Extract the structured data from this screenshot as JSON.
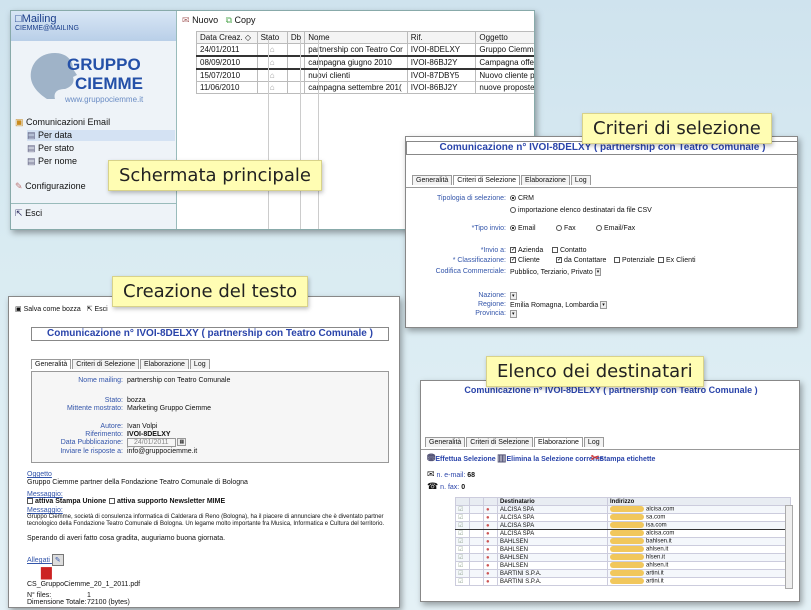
{
  "callouts": {
    "main": "Schermata principale",
    "criteri": "Criteri di selezione",
    "creazione": "Creazione del testo",
    "elenco": "Elenco dei destinatari"
  },
  "main": {
    "app_title": "Mailing",
    "app_subtitle": "CIEMME@MAILING",
    "logo_line1": "GRUPPO",
    "logo_line2": "CIEMME",
    "logo_url": "www.gruppociemme.it",
    "nav_section": "Comunicazioni Email",
    "nav_items": [
      "Per data",
      "Per stato",
      "Per nome"
    ],
    "configurazione": "Configurazione",
    "esci": "Esci",
    "toolbar": {
      "nuovo": "Nuovo",
      "copy": "Copy"
    },
    "columns": [
      "Data Creaz.",
      "Stato",
      "Db",
      "Nome",
      "Rif.",
      "Oggetto"
    ],
    "rows": [
      [
        "24/01/2011",
        "partnership con Teatro Cor",
        "IVOI-8DELXY",
        "Gruppo Ciemme"
      ],
      [
        "08/09/2010",
        "campagna giugno 2010",
        "IVOI-86BJ2Y",
        "Campagna offerta"
      ],
      [
        "15/07/2010",
        "nuovi clienti",
        "IVOI-87DBY5",
        "Nuovo cliente per"
      ],
      [
        "11/06/2010",
        "campagna settembre 201(",
        "IVOI-86BJ2Y",
        "nuove proposte d"
      ]
    ]
  },
  "criteri": {
    "title": "Comunicazione n° IVOI-8DELXY ( partnership con Teatro Comunale )",
    "tabs": [
      "Generalità",
      "Criteri di Selezione",
      "Elaborazione",
      "Log"
    ],
    "tipologia_label": "Tipologia di selezione:",
    "tipologia_opt1": "CRM",
    "tipologia_opt2": "importazione elenco destinatari da file CSV",
    "tipo_invio_label": "*Tipo invio:",
    "tipo_invio_opts": [
      "Email",
      "Fax",
      "Email/Fax"
    ],
    "invio_a_label": "*Invio a:",
    "invio_a_opts": [
      "Azienda",
      "Contatto"
    ],
    "classificazione_label": "* Classificazione:",
    "classificazione_opts": [
      "Cliente",
      "da Contattare",
      "Potenziale",
      "Ex Clienti"
    ],
    "codifica_label": "Codifica Commerciale:",
    "codifica_value": "Pubblico, Terziario, Privato",
    "nazione_label": "Nazione:",
    "regione_label": "Regione:",
    "regione_value": "Emilia Romagna, Lombardia",
    "provincia_label": "Provincia:"
  },
  "creazione": {
    "toolbar_save": "Salva come bozza",
    "toolbar_exit": "Esci",
    "title": "Comunicazione n° IVOI-8DELXY ( partnership con Teatro Comunale )",
    "tabs": [
      "Generalità",
      "Criteri di Selezione",
      "Elaborazione",
      "Log"
    ],
    "nome_label": "Nome mailing:",
    "nome_value": "partnership con Teatro Comunale",
    "stato_label": "Stato:",
    "stato_value": "bozza",
    "mittente_label": "Mittente mostrato:",
    "mittente_value": "Marketing Gruppo Ciemme",
    "autore_label": "Autore:",
    "autore_value": "Ivan Volpi",
    "riferimento_label": "Riferimento:",
    "riferimento_value": "IVOI-8DELXY",
    "data_label": "Data Pubblicazione:",
    "data_value": "24/01/2011",
    "risposte_label": "Inviare le risposte a:",
    "risposte_value": "info@gruppociemme.it",
    "oggetto_label": "Oggetto",
    "oggetto_value": "Gruppo Ciemme partner della Fondazione Teatro Comunale di Bologna",
    "messaggio_label": "Messaggio:",
    "opt_stampa": "attiva Stampa Unione",
    "opt_newsletter": "attiva supporto Newsletter MIME",
    "messaggio_label2": "Messaggio:",
    "messaggio_text": "Gruppo Ciemme, società di consulenza informatica di Calderara di Reno (Bologna), ha il piacere di annunciare che è diventato partner tecnologico della Fondazione Teatro Comunale di Bologna. Un legame molto importante fra Musica, Informatica e Cultura del territorio.",
    "saluto": "Sperando di averi fatto cosa gradita, auguriamo buona giornata.",
    "allegati_label": "Allegati",
    "file_name": "CS_GruppoCiemme_20_1_2011.pdf",
    "nfiles_label": "N° files:",
    "nfiles_value": "1",
    "dimensione_label": "Dimensione Totale:",
    "dimensione_value": "72100 (bytes)"
  },
  "elenco": {
    "title": "Comunicazione n° IVOI-8DELXY ( partnership con Teatro Comunale )",
    "tabs": [
      "Generalità",
      "Criteri di Selezione",
      "Elaborazione",
      "Log"
    ],
    "btn_effettua": "Effettua Selezione",
    "btn_elimina": "Elimina la Selezione corrente",
    "btn_stampa": "Stampa etichette",
    "email_label": "n. e-mail:",
    "email_count": "68",
    "fax_label": "n. fax:",
    "fax_count": "0",
    "col_dest": "Destinatario",
    "col_ind": "Indirizzo",
    "rows": [
      [
        "ALCISA SPA",
        "alcisa.com"
      ],
      [
        "ALCISA SPA",
        "sa.com"
      ],
      [
        "ALCISA SPA",
        "isa.com"
      ],
      [
        "ALCISA SPA",
        "alcisa.com"
      ],
      [
        "BAHLSEN",
        "bahlsen.it"
      ],
      [
        "BAHLSEN",
        "ahlsen.it"
      ],
      [
        "BAHLSEN",
        "hlsen.it"
      ],
      [
        "BAHLSEN",
        "ahlsen.it"
      ],
      [
        "BARTINI S.P.A.",
        "artini.it"
      ],
      [
        "BARTINI S.P.A.",
        "artini.it"
      ]
    ]
  }
}
